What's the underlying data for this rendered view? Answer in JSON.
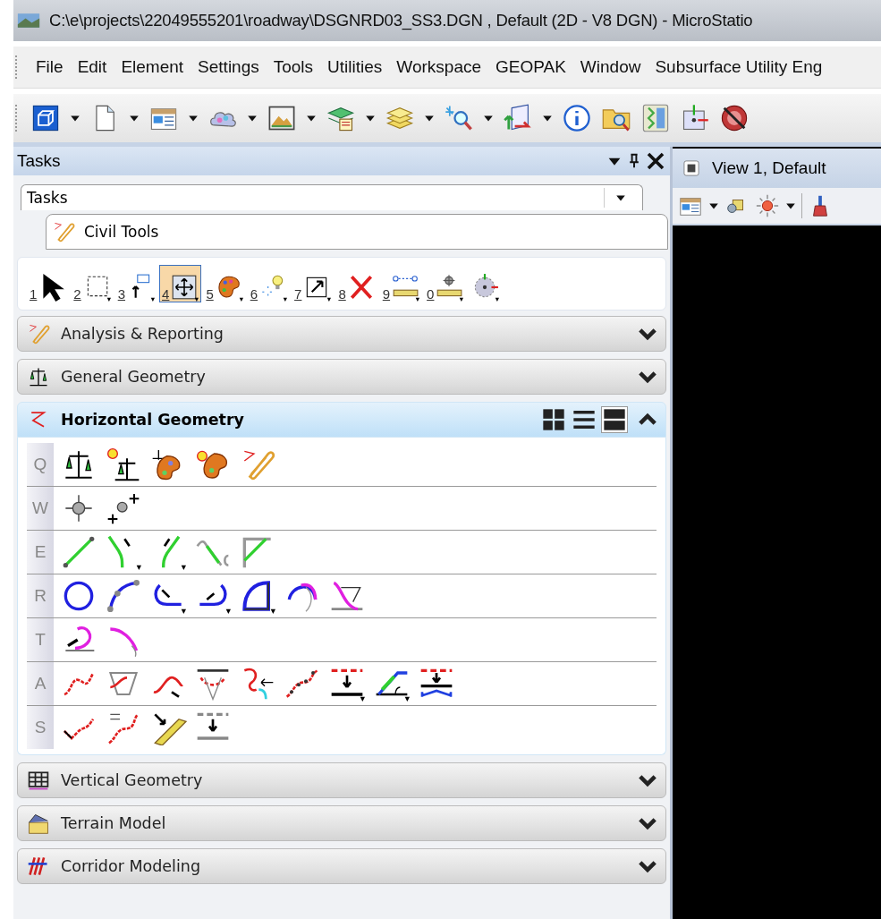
{
  "window": {
    "title": "C:\\e\\projects\\22049555201\\roadway\\DSGNRD03_SS3.DGN , Default (2D - V8 DGN) - MicroStatio"
  },
  "menu": [
    {
      "label": "File"
    },
    {
      "label": "Edit"
    },
    {
      "label": "Element"
    },
    {
      "label": "Settings"
    },
    {
      "label": "Tools"
    },
    {
      "label": "Utilities"
    },
    {
      "label": "Workspace"
    },
    {
      "label": "GEOPAK"
    },
    {
      "label": "Window"
    },
    {
      "label": "Subsurface Utility Eng"
    }
  ],
  "tasks": {
    "title": "Tasks",
    "dropdown": {
      "value": "Tasks"
    },
    "tab": {
      "label": "Civil Tools"
    },
    "tools": [
      {
        "key": "1",
        "selected": false
      },
      {
        "key": "2",
        "selected": false
      },
      {
        "key": "3",
        "selected": false
      },
      {
        "key": "4",
        "selected": true
      },
      {
        "key": "5",
        "selected": false
      },
      {
        "key": "6",
        "selected": false
      },
      {
        "key": "7",
        "selected": false
      },
      {
        "key": "8",
        "selected": false
      },
      {
        "key": "9",
        "selected": false
      },
      {
        "key": "0",
        "selected": false
      },
      {
        "selected": false
      }
    ],
    "sections": [
      {
        "title": "Analysis & Reporting",
        "expanded": false
      },
      {
        "title": "General Geometry",
        "expanded": false
      },
      {
        "title": "Horizontal Geometry",
        "expanded": true,
        "view_modes": [
          {
            "selected": false
          },
          {
            "selected": false
          },
          {
            "selected": true
          }
        ],
        "rows": [
          {
            "key": "Q"
          },
          {
            "key": "W"
          },
          {
            "key": "E"
          },
          {
            "key": "R"
          },
          {
            "key": "T"
          },
          {
            "key": "A"
          },
          {
            "key": "S"
          }
        ]
      },
      {
        "title": "Vertical Geometry",
        "expanded": false
      },
      {
        "title": "Terrain Model",
        "expanded": false
      },
      {
        "title": "Corridor Modeling",
        "expanded": false
      }
    ]
  },
  "view": {
    "title": "View 1, Default"
  }
}
